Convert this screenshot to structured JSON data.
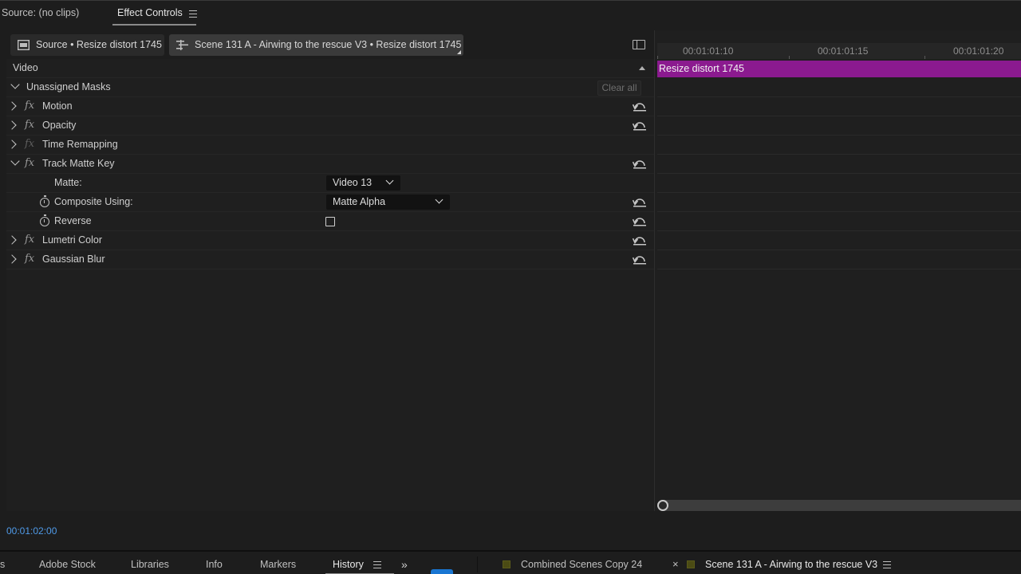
{
  "top_tabs": {
    "source_label": "Source: (no clips)",
    "effect_controls_label": "Effect Controls"
  },
  "sequence_bar": {
    "source_button": "Source • Resize distort 1745",
    "scene_button": "Scene 131 A - Airwing to the rescue V3 • Resize distort 1745"
  },
  "controls": {
    "video_header": "Video",
    "unassigned_masks": "Unassigned Masks",
    "clear_all": "Clear all",
    "effects": {
      "motion": "Motion",
      "opacity": "Opacity",
      "time_remapping": "Time Remapping",
      "track_matte_key": "Track Matte Key",
      "lumetri_color": "Lumetri Color",
      "gaussian_blur": "Gaussian Blur"
    },
    "params": {
      "matte_label": "Matte:",
      "matte_value": "Video 13",
      "composite_label": "Composite Using:",
      "composite_value": "Matte Alpha",
      "reverse_label": "Reverse",
      "reverse_checked": false
    },
    "fx_glyph": "fx"
  },
  "timeline": {
    "ruler_labels": [
      "00:01:01:10",
      "00:01:01:15",
      "00:01:01:20"
    ],
    "clip_label": "Resize distort 1745"
  },
  "timecode": "00:01:02:00",
  "bottom_tabs": {
    "partial": "s",
    "adobe_stock": "Adobe Stock",
    "libraries": "Libraries",
    "info": "Info",
    "markers": "Markers",
    "history": "History",
    "overflow": "»",
    "seq_combined": "Combined Scenes Copy 24",
    "close_glyph": "×",
    "seq_scene": "Scene 131 A - Airwing to the rescue V3"
  },
  "colors": {
    "clip": "#8b1a8f",
    "timecode": "#4f9ae8",
    "accent_blue": "#1976d2",
    "sequence_swatch": "#4b4b14"
  },
  "icons": {
    "panel_menu": "hamburger-menu-icon",
    "reset": "reset-parameter-icon",
    "stopwatch": "stopwatch-icon",
    "fx": "fx-badge-icon"
  }
}
